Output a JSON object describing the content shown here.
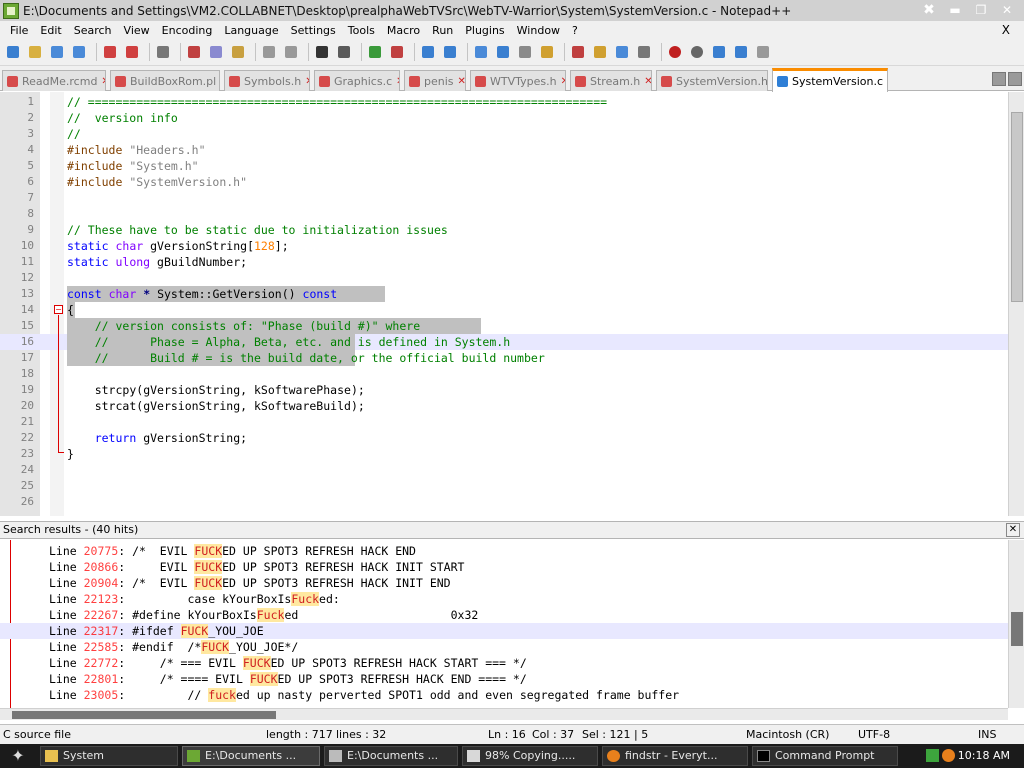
{
  "window": {
    "title": "E:\\Documents and Settings\\VM2.COLLABNET\\Desktop\\prealphaWebTVSrc\\WebTV-Warrior\\System\\SystemVersion.c - Notepad++",
    "pin_glyph": "✖",
    "minimize_glyph": "▬",
    "maximize_glyph": "❐",
    "close_glyph": "✕"
  },
  "menu": {
    "items": [
      "File",
      "Edit",
      "Search",
      "View",
      "Encoding",
      "Language",
      "Settings",
      "Tools",
      "Macro",
      "Run",
      "Plugins",
      "Window",
      "?"
    ],
    "close_label": "X"
  },
  "toolbar": {
    "icons": [
      "new-file-icon",
      "open-file-icon",
      "save-icon",
      "save-all-icon",
      "close-file-icon",
      "close-all-icon",
      "print-icon",
      "cut-icon",
      "copy-icon",
      "paste-icon",
      "undo-icon",
      "redo-icon",
      "find-icon",
      "replace-icon",
      "zoom-in-icon",
      "zoom-out-icon",
      "sync-vertical-icon",
      "sync-horizontal-icon",
      "word-wrap-icon",
      "show-all-chars-icon",
      "indent-guide-icon",
      "user-language-icon",
      "doc-map-icon",
      "function-list-icon",
      "folder-workspace-icon",
      "monitoring-icon",
      "record-macro-icon",
      "stop-record-icon",
      "play-macro-icon",
      "run-macro-multiple-icon",
      "save-macro-icon"
    ]
  },
  "tabs": [
    {
      "label": "ReadMe.rcmd",
      "active": false
    },
    {
      "label": "BuildBoxRom.pl",
      "active": false
    },
    {
      "label": "Symbols.h",
      "active": false
    },
    {
      "label": "Graphics.c",
      "active": false
    },
    {
      "label": "penis",
      "active": false
    },
    {
      "label": "WTVTypes.h",
      "active": false
    },
    {
      "label": "Stream.h",
      "active": false
    },
    {
      "label": "SystemVersion.h",
      "active": false
    },
    {
      "label": "SystemVersion.c",
      "active": true
    }
  ],
  "tab_close_glyph": "✕",
  "editor": {
    "lines": [
      {
        "n": "1",
        "text": "// ==========================================================================="
      },
      {
        "n": "2",
        "text": "//  version info"
      },
      {
        "n": "3",
        "text": "//"
      },
      {
        "n": "4",
        "text": "#include \"Headers.h\""
      },
      {
        "n": "5",
        "text": "#include \"System.h\""
      },
      {
        "n": "6",
        "text": "#include \"SystemVersion.h\""
      },
      {
        "n": "7",
        "text": ""
      },
      {
        "n": "8",
        "text": ""
      },
      {
        "n": "9",
        "text": "// These have to be static due to initialization issues"
      },
      {
        "n": "10",
        "text": "static char gVersionString[128];"
      },
      {
        "n": "11",
        "text": "static ulong gBuildNumber;"
      },
      {
        "n": "12",
        "text": ""
      },
      {
        "n": "13",
        "text": "const char * System::GetVersion() const"
      },
      {
        "n": "14",
        "text": "{"
      },
      {
        "n": "15",
        "text": "    // version consists of: \"Phase (build #)\" where"
      },
      {
        "n": "16",
        "text": "    //      Phase = Alpha, Beta, etc. and is defined in System.h"
      },
      {
        "n": "17",
        "text": "    //      Build # = is the build date, or the official build number"
      },
      {
        "n": "18",
        "text": ""
      },
      {
        "n": "19",
        "text": "    strcpy(gVersionString, kSoftwarePhase);"
      },
      {
        "n": "20",
        "text": "    strcat(gVersionString, kSoftwareBuild);"
      },
      {
        "n": "21",
        "text": ""
      },
      {
        "n": "22",
        "text": "    return gVersionString;"
      },
      {
        "n": "23",
        "text": "}"
      },
      {
        "n": "24",
        "text": ""
      },
      {
        "n": "25",
        "text": ""
      },
      {
        "n": "26",
        "text": ""
      }
    ],
    "fold_glyph": "−"
  },
  "search": {
    "header": "Search results - (40 hits)",
    "close_glyph": "✕",
    "results": [
      {
        "pre": "Line ",
        "num": "20775",
        "body": [
          ": /*  EVIL ",
          {
            "hit": "FUCK"
          },
          "ED UP SPOT3 REFRESH HACK END"
        ]
      },
      {
        "pre": "Line ",
        "num": "20866",
        "body": [
          ":     EVIL ",
          {
            "hit": "FUCK"
          },
          "ED UP SPOT3 REFRESH HACK INIT START"
        ]
      },
      {
        "pre": "Line ",
        "num": "20904",
        "body": [
          ": /*  EVIL ",
          {
            "hit": "FUCK"
          },
          "ED UP SPOT3 REFRESH HACK INIT END"
        ]
      },
      {
        "pre": "Line ",
        "num": "22123",
        "body": [
          ":         case kYourBoxIs",
          {
            "hit": "Fuck"
          },
          "ed:"
        ]
      },
      {
        "pre": "Line ",
        "num": "22267",
        "body": [
          ": #define kYourBoxIs",
          {
            "hit": "Fuck"
          },
          "ed                      0x32"
        ]
      },
      {
        "pre": "Line ",
        "num": "22317",
        "body": [
          ": #ifdef ",
          {
            "hit": "FUCK"
          },
          "_YOU_JOE"
        ]
      },
      {
        "pre": "Line ",
        "num": "22585",
        "body": [
          ": #endif  /*",
          {
            "hit": "FUCK"
          },
          "_YOU_JOE*/"
        ]
      },
      {
        "pre": "Line ",
        "num": "22772",
        "body": [
          ":     /* === EVIL ",
          {
            "hit": "FUCK"
          },
          "ED UP SPOT3 REFRESH HACK START === */"
        ]
      },
      {
        "pre": "Line ",
        "num": "22801",
        "body": [
          ":     /* ==== EVIL ",
          {
            "hit": "FUCK"
          },
          "ED UP SPOT3 REFRESH HACK END ==== */"
        ]
      },
      {
        "pre": "Line ",
        "num": "23005",
        "body": [
          ":         // ",
          {
            "hit": "fuck"
          },
          "ed up nasty perverted SPOT1 odd and even segregated frame buffer"
        ]
      }
    ]
  },
  "status": {
    "file_type": "C source file",
    "length": "length : 717",
    "lines": "lines : 32",
    "ln": "Ln : 16",
    "col": "Col : 37",
    "sel": "Sel : 121 | 5",
    "eol": "Macintosh (CR)",
    "encoding": "UTF-8",
    "mode": "INS"
  },
  "taskbar": {
    "start_glyph": "✦",
    "tasks": [
      {
        "label": "System"
      },
      {
        "label": "E:\\Documents ..."
      },
      {
        "label": "E:\\Documents ..."
      },
      {
        "label": "98% Copying....."
      },
      {
        "label": "findstr - Everyt..."
      },
      {
        "label": "Command Prompt"
      }
    ],
    "clock": "10:18 AM"
  },
  "colors": {
    "active_tab_accent": "#fa8c00",
    "fold_marker": "#dd0000",
    "comment": "#008000",
    "keyword": "#0000ff",
    "type": "#8000ff",
    "number": "#ff8000",
    "hit_highlight": "#ffe8a0"
  }
}
